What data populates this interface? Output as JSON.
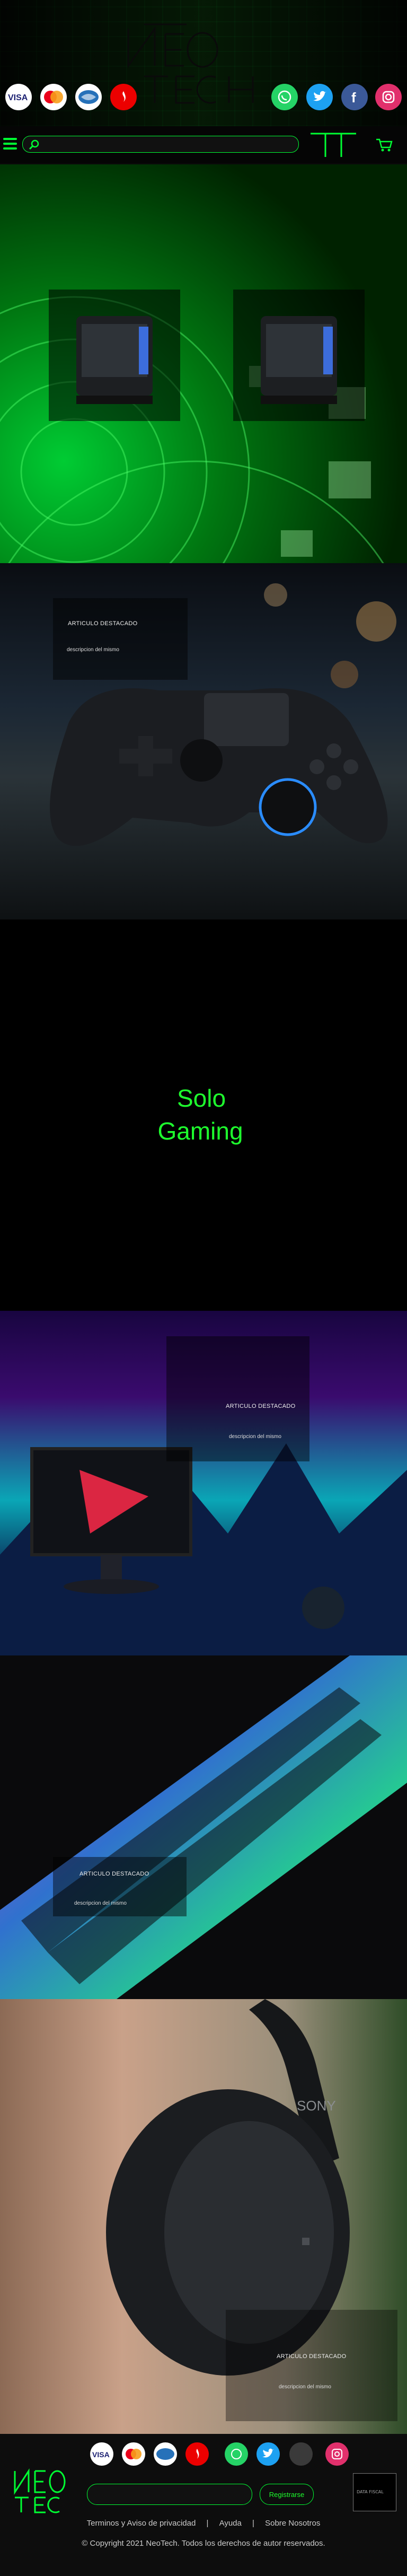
{
  "header": {
    "brand": "NEOTECH",
    "payment_icons": [
      "visa-icon",
      "mastercard-icon",
      "amex-icon",
      "santander-icon"
    ],
    "social_icons": [
      "whatsapp-icon",
      "twitter-icon",
      "facebook-icon",
      "instagram-icon"
    ]
  },
  "nav": {
    "menu_icon": "hamburger-icon",
    "search_icon": "search-icon",
    "cart_icon": "cart-icon"
  },
  "features": [
    {
      "title": "ARTICULO DESTACADO",
      "desc": "descripcion del mismo"
    },
    {
      "title": "ARTICULO DESTACADO",
      "desc": "descripcion del mismo"
    },
    {
      "title": "ARTICULO DESTACADO",
      "desc": "descripcion del mismo"
    },
    {
      "title": "ARTICULO DESTACADO",
      "desc": "descripcion del mismo"
    }
  ],
  "gaming": {
    "line1": "Solo",
    "line2": "Gaming"
  },
  "footer": {
    "register_button": "Registrarse",
    "links": [
      "Terminos y Aviso de privacidad",
      "|",
      "Ayuda",
      "|",
      "Sobre Nosotros"
    ],
    "copyright": "Copyright 2021 NeoTech. Todos los derechos de autor reservados.",
    "qr_label": "DATA FISCAL"
  },
  "colors": {
    "accent": "#1eff2e",
    "background": "#000000"
  }
}
